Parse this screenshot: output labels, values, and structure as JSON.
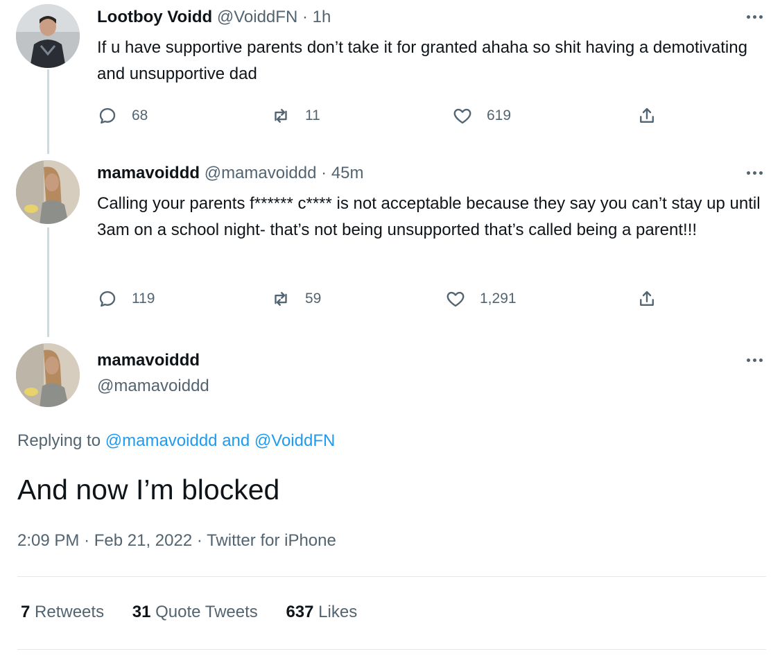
{
  "thread": [
    {
      "display_name": "Lootboy Voidd",
      "handle": "@VoiddFN",
      "separator": "·",
      "time": "1h",
      "text": "If u have supportive parents don’t take it for granted ahaha so shit having a demotivating and unsupportive dad",
      "replies": "68",
      "retweets": "11",
      "likes": "619"
    },
    {
      "display_name": "mamavoiddd",
      "handle": "@mamavoiddd",
      "separator": "·",
      "time": "45m",
      "text": "Calling your parents f****** c**** is not acceptable because they say you can’t stay up until 3am on a school night- that’s not being unsupported that’s called being a parent!!!",
      "replies": "119",
      "retweets": "59",
      "likes": "1,291"
    }
  ],
  "focal": {
    "display_name": "mamavoiddd",
    "handle": "@mamavoiddd",
    "replying_prefix": "Replying to",
    "replying_user1": "@mamavoiddd",
    "replying_and": "and",
    "replying_user2": "@VoiddFN",
    "text": "And now I’m blocked",
    "time": "2:09 PM",
    "separator": "·",
    "date": "Feb 21, 2022",
    "source": "Twitter for iPhone",
    "retweets_count": "7",
    "retweets_label": "Retweets",
    "quotes_count": "31",
    "quotes_label": "Quote Tweets",
    "likes_count": "637",
    "likes_label": "Likes"
  },
  "icons": {
    "reply": "reply-icon",
    "retweet": "retweet-icon",
    "like": "heart-icon",
    "share": "share-icon",
    "more": "more-icon"
  },
  "colors": {
    "text_primary": "#0f1419",
    "text_secondary": "#536471",
    "link": "#1d9bf0",
    "thread_line": "#cfd9de"
  }
}
